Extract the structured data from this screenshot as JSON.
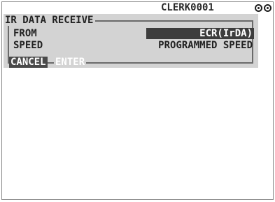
{
  "header": {
    "clerk_label": "CLERK0001",
    "status_icons": [
      "circle-indicator-icon",
      "circle-indicator-icon"
    ]
  },
  "dialog": {
    "title": "IR DATA RECEIVE",
    "rows": [
      {
        "label": "FROM",
        "value": "ECR(IrDA)",
        "selected": true
      },
      {
        "label": "SPEED",
        "value": "PROGRAMMED SPEED",
        "selected": false
      }
    ]
  },
  "buttons": {
    "cancel_label": "CANCEL",
    "enter_label": "ENTER"
  },
  "colors": {
    "panel_bg": "#d3d3d3",
    "selected_bg": "#3d3d3d",
    "cancel_bg": "#4a4a4a"
  }
}
